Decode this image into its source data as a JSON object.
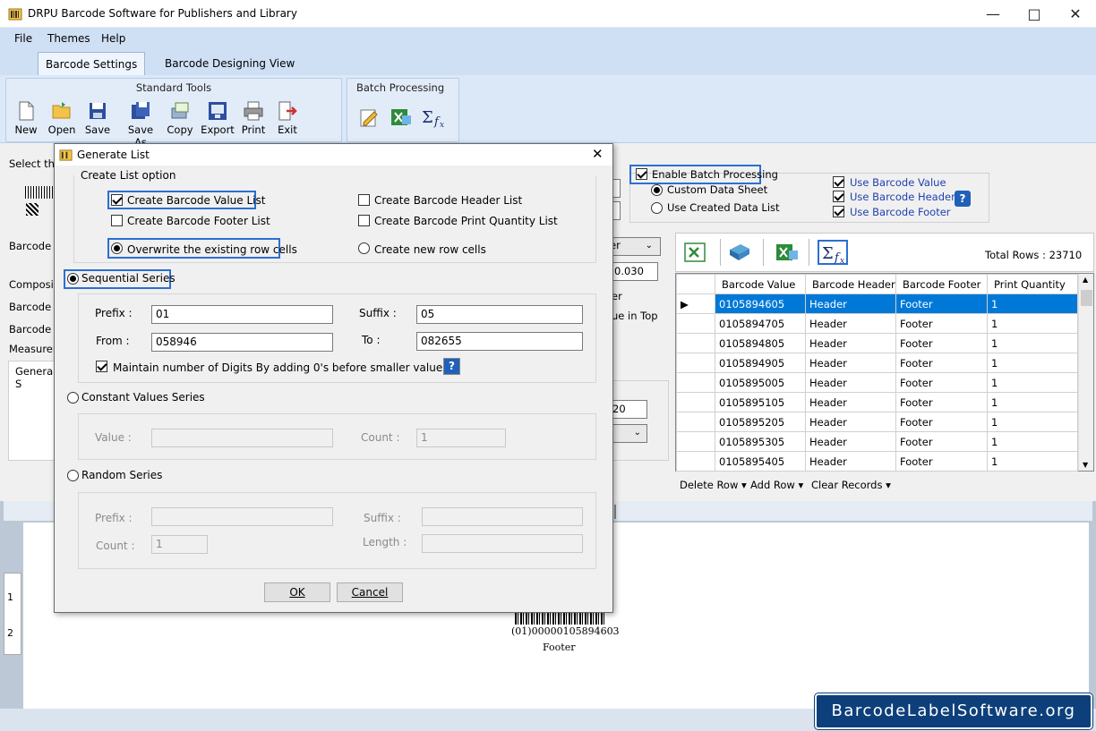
{
  "window": {
    "title": "DRPU Barcode Software for Publishers and Library"
  },
  "menu": {
    "file": "File",
    "themes": "Themes",
    "help": "Help"
  },
  "tabs": {
    "settings": "Barcode Settings",
    "designing": "Barcode Designing View"
  },
  "ribbon": {
    "standard_tools_label": "Standard Tools",
    "batch_label": "Batch Processing",
    "tools": [
      "New",
      "Open",
      "Save",
      "Save As",
      "Copy",
      "Export",
      "Print",
      "Exit"
    ]
  },
  "background": {
    "select_the": "Select the",
    "barcode_v": "Barcode V",
    "composite": "Composite",
    "barcode_h": "Barcode H",
    "barcode_f": "Barcode F",
    "measurem": "Measurem",
    "general_s": "General S",
    "spin_value": "0.030",
    "spin_value2": "20",
    "er_text": "er",
    "ue_in_top": "ue in Top",
    "frag_r": "er"
  },
  "batch": {
    "enable_label": "Enable Batch Processing",
    "custom_data_sheet": "Custom Data Sheet",
    "use_created_list": "Use Created Data List",
    "use_value": "Use Barcode Value",
    "use_header": "Use Barcode Header",
    "use_footer": "Use Barcode Footer",
    "total_rows": "Total Rows : 23710"
  },
  "grid": {
    "columns": [
      "Barcode Value",
      "Barcode Header",
      "Barcode Footer",
      "Print Quantity"
    ],
    "rows": [
      [
        "0105894605",
        "Header",
        "Footer",
        "1"
      ],
      [
        "0105894705",
        "Header",
        "Footer",
        "1"
      ],
      [
        "0105894805",
        "Header",
        "Footer",
        "1"
      ],
      [
        "0105894905",
        "Header",
        "Footer",
        "1"
      ],
      [
        "0105895005",
        "Header",
        "Footer",
        "1"
      ],
      [
        "0105895105",
        "Header",
        "Footer",
        "1"
      ],
      [
        "0105895205",
        "Header",
        "Footer",
        "1"
      ],
      [
        "0105895305",
        "Header",
        "Footer",
        "1"
      ],
      [
        "0105895405",
        "Header",
        "Footer",
        "1"
      ]
    ],
    "delete_row": "Delete Row",
    "add_row": "Add Row",
    "clear_records": "Clear Records"
  },
  "preview": {
    "barcode_text": "(01)00000105894603",
    "footer": "Footer",
    "ruler": [
      "1",
      "2"
    ]
  },
  "dialog": {
    "title": "Generate List",
    "create_list_option": "Create List option",
    "create_value_list": "Create Barcode Value List",
    "create_header_list": "Create Barcode Header List",
    "create_footer_list": "Create Barcode Footer List",
    "create_qty_list": "Create Barcode Print Quantity List",
    "overwrite": "Overwrite the existing row cells",
    "create_new_rows": "Create new row cells",
    "sequential": "Sequential Series",
    "prefix_label": "Prefix :",
    "prefix_value": "01",
    "suffix_label": "Suffix :",
    "suffix_value": "05",
    "from_label": "From :",
    "from_value": "058946",
    "to_label": "To :",
    "to_value": "082655",
    "maintain_digits": "Maintain number of Digits By adding 0's before smaller values.",
    "constant": "Constant Values Series",
    "value_label": "Value :",
    "count_label": "Count :",
    "count_value": "1",
    "random": "Random Series",
    "r_prefix_label": "Prefix :",
    "r_suffix_label": "Suffix :",
    "r_count_label": "Count :",
    "r_count_value": "1",
    "r_length_label": "Length :",
    "ok": "OK",
    "cancel": "Cancel"
  },
  "watermark": "BarcodeLabelSoftware.org"
}
